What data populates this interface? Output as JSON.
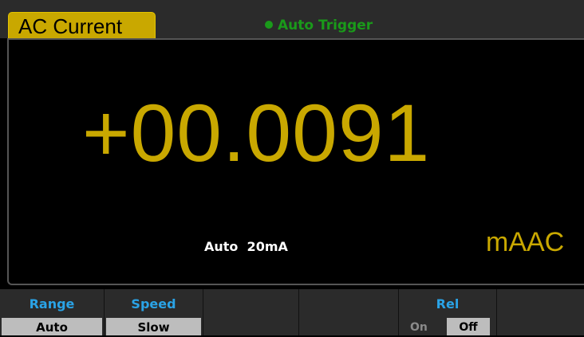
{
  "header": {
    "mode_tab": "AC Current",
    "trigger_status": "Auto Trigger",
    "trigger_color": "#1a9a1a"
  },
  "display": {
    "reading": "+00.0091",
    "range": "Auto  20mA",
    "unit": "mAAC",
    "reading_color": "#c9a800"
  },
  "softkeys": [
    {
      "title": "Range",
      "value": "Auto"
    },
    {
      "title": "Speed",
      "value": "Slow"
    },
    {
      "title": "",
      "value": ""
    },
    {
      "title": "",
      "value": ""
    },
    {
      "title": "Rel",
      "options": [
        "On",
        "Off"
      ],
      "selected": "Off"
    },
    {
      "title": "",
      "value": ""
    }
  ]
}
